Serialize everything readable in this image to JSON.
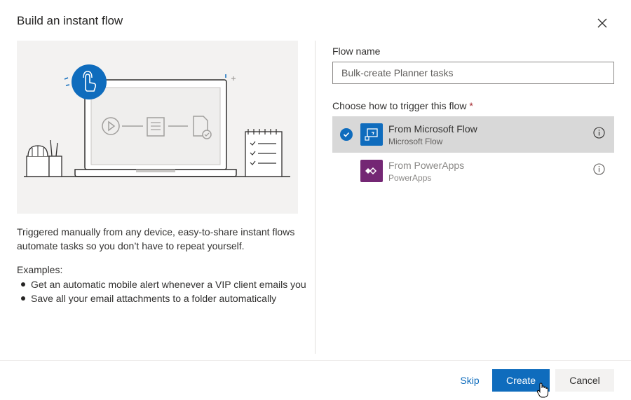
{
  "dialog": {
    "title": "Build an instant flow"
  },
  "description": "Triggered manually from any device, easy-to-share instant flows automate tasks so you don’t have to repeat yourself.",
  "examples": {
    "label": "Examples:",
    "items": [
      "Get an automatic mobile alert whenever a VIP client emails you",
      "Save all your email attachments to a folder automatically"
    ]
  },
  "form": {
    "flow_name_label": "Flow name",
    "flow_name_value": "Bulk-create Planner tasks",
    "trigger_label": "Choose how to trigger this flow",
    "required_mark": "*"
  },
  "triggers": [
    {
      "title": "From Microsoft Flow",
      "subtitle": "Microsoft Flow",
      "selected": true,
      "icon": "microsoft-flow-icon",
      "color": "#0f6cbd"
    },
    {
      "title": "From PowerApps",
      "subtitle": "PowerApps",
      "selected": false,
      "icon": "powerapps-icon",
      "color": "#742774"
    }
  ],
  "footer": {
    "skip_label": "Skip",
    "create_label": "Create",
    "cancel_label": "Cancel"
  },
  "colors": {
    "accent": "#0f6cbd",
    "powerapps": "#742774",
    "selected_row": "#d8d8d8"
  }
}
